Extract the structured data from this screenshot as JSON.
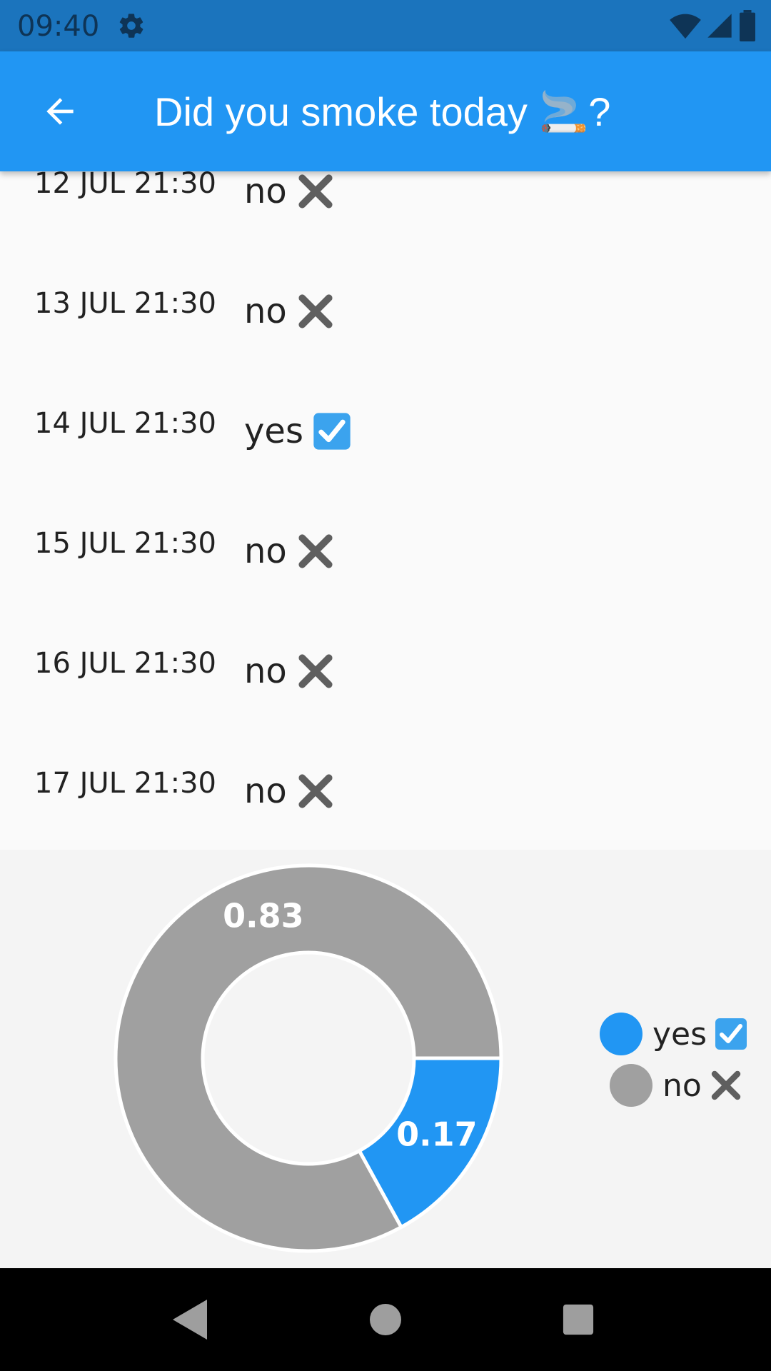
{
  "status_bar": {
    "time": "09:40",
    "icons": [
      "gear-icon",
      "wifi-icon",
      "signal-icon",
      "battery-icon"
    ]
  },
  "app_bar": {
    "back_icon": "arrow-back-icon",
    "title": "Did you smoke today 🚬?"
  },
  "list": {
    "items": [
      {
        "date": "12 JUL 21:30",
        "answer": "no",
        "icon": "cross-icon"
      },
      {
        "date": "13 JUL 21:30",
        "answer": "no",
        "icon": "cross-icon"
      },
      {
        "date": "14 JUL 21:30",
        "answer": "yes",
        "icon": "check-box-icon"
      },
      {
        "date": "15 JUL 21:30",
        "answer": "no",
        "icon": "cross-icon"
      },
      {
        "date": "16 JUL 21:30",
        "answer": "no",
        "icon": "cross-icon"
      },
      {
        "date": "17 JUL 21:30",
        "answer": "no",
        "icon": "cross-icon"
      }
    ]
  },
  "chart_data": {
    "type": "pie",
    "variant": "donut",
    "series": [
      {
        "name": "yes ☑️",
        "value": 0.17,
        "label": "0.17",
        "color": "#2196f3"
      },
      {
        "name": "no ❌",
        "value": 0.83,
        "label": "0.83",
        "color": "#a0a0a0"
      }
    ],
    "legend_placement": "right",
    "legend": [
      {
        "label": "yes",
        "icon": "check-box-icon",
        "color": "#2196f3"
      },
      {
        "label": "no",
        "icon": "cross-icon",
        "color": "#a0a0a0"
      }
    ]
  },
  "colors": {
    "status_bar": "#1b74bd",
    "app_bar": "#2196f3",
    "background": "#fafafa",
    "chart_background": "#f4f4f4",
    "yes": "#2196f3",
    "no": "#a0a0a0"
  },
  "nav_bar": {
    "icons": [
      "back-triangle-icon",
      "home-circle-icon",
      "recents-square-icon"
    ]
  }
}
